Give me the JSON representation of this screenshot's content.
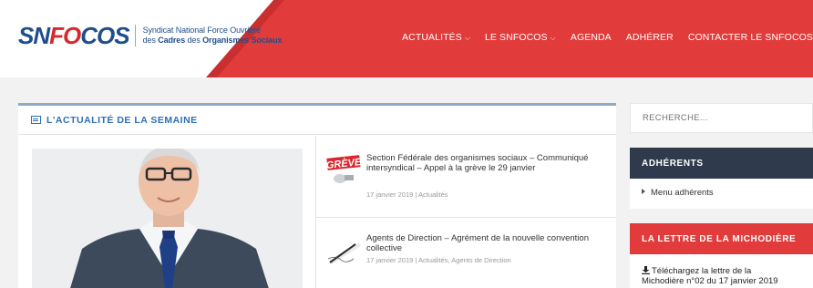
{
  "header": {
    "logo": {
      "mark_sn": "SN",
      "mark_fo": "FO",
      "mark_cos": "COS",
      "line1": "Syndicat National Force Ouvrière",
      "line2_pre": "des ",
      "line2_b1": "Cadres",
      "line2_mid": " des ",
      "line2_b2": "Organismes Sociaux"
    },
    "nav": [
      {
        "label": "ACTUALITÉS",
        "dropdown": true
      },
      {
        "label": "LE SNFOCOS",
        "dropdown": true
      },
      {
        "label": "AGENDA",
        "dropdown": false
      },
      {
        "label": "ADHÉRER",
        "dropdown": false
      },
      {
        "label": "CONTACTER LE SNFOCOS",
        "dropdown": false
      }
    ],
    "brand_red": "#e23b3b"
  },
  "news": {
    "section_title": "L'ACTUALITÉ DE LA SEMAINE",
    "accent": "#2f6fb3",
    "articles": [
      {
        "title": "Section Fédérale des organismes sociaux – Communiqué intersyndical – Appel à la grève le 29 janvier",
        "meta": "17 janvier 2019 | Actualités",
        "thumb_label": "GRÈVE"
      },
      {
        "title": "Agents de Direction – Agrément de la nouvelle convention collective",
        "meta": "17 janvier 2019 | Actualités, Agents de Direction"
      }
    ]
  },
  "sidebar": {
    "search_placeholder": "RECHERCHE...",
    "adherents": {
      "title": "ADHÉRENTS",
      "link": "Menu adhérents",
      "color": "#2f3b4d"
    },
    "lettre": {
      "title": "LA LETTRE DE LA MICHODIÈRE",
      "link_line1": "Téléchargez la lettre de la",
      "link_line2": "Michodière n°02 du 17 janvier 2019",
      "color": "#e23b3b"
    }
  }
}
